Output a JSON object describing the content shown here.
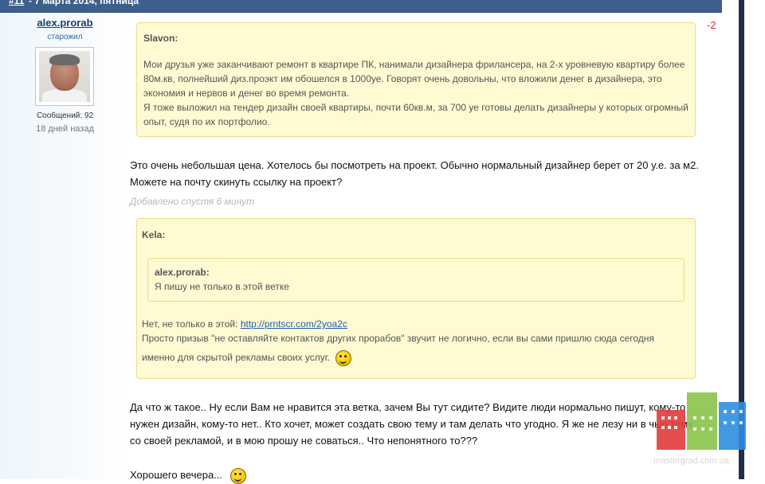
{
  "header": {
    "post_number": "#11",
    "post_date": " - 7 марта 2014, пятница"
  },
  "author": {
    "username": "alex.prorab",
    "rank": "старожил",
    "messages_label": "Сообщений: 92",
    "last_seen": "18 дней назад"
  },
  "post": {
    "rating": "-2",
    "quote1": {
      "author": "Slavon:",
      "lines": [
        "Мои друзья уже заканчивают ремонт в квартире ПК, нанимали дизайнера фрилансера, на 2-х уровневую квартиру более",
        "80м.кв, полнейший диз.проэкт им обошелся в 1000уе. Говорят очень довольны, что вложили денег в дизайнера, это",
        "экономия и нервов и денег во время ремонта.",
        "Я тоже выложил на тендер дизайн своей квартиры, почти 60кв.м, за 700 уе готовы делать дизайнеры у которых огромный",
        "опыт, судя по их портфолио."
      ]
    },
    "reply1": [
      "Это очень небольшая цена. Хотелось бы посмотреть на проект. Обычно нормальный дизайнер берет от 20 у.е. за м2.",
      "Можете на почту скинуть ссылку на проект?"
    ],
    "added_note": "Добавлено спустя 6 минут",
    "quote2": {
      "author": "Kela:",
      "nested": {
        "author": "alex.prorab:",
        "text": "Я пишу не только в этой ветке"
      },
      "line1_prefix": "Нет, не только в этой: ",
      "link": "http://prntscr.com/2yoa2c",
      "line2": "Просто призыв \"не оставляйте контактов других прорабов\" звучит не логично, если вы сами пришлю сюда сегодня",
      "line3": "именно для скрытой рекламы своих услуг."
    },
    "reply2": [
      "Да что ж такое.. Ну если Вам не нравится эта ветка, зачем Вы тут сидите? Видите люди нормально пишут, кому-то",
      "нужен дизайн, кому-то нет.. Кто хочет, может создать свою тему и там делать что угодно. Я же не лезу ни в чью тему",
      "со своей рекламой, и в мою прошу не соваться.. Что непонятного то???"
    ],
    "closing": "Хорошего вечера..."
  },
  "watermark": {
    "text": "mastergrad.com.ua"
  },
  "colors": {
    "header_bar": "#3d5f8c",
    "quote_bg": "#fffad2",
    "quote_border": "#e9dc8c",
    "rating": "#d03030",
    "link": "#1f5fb3"
  }
}
